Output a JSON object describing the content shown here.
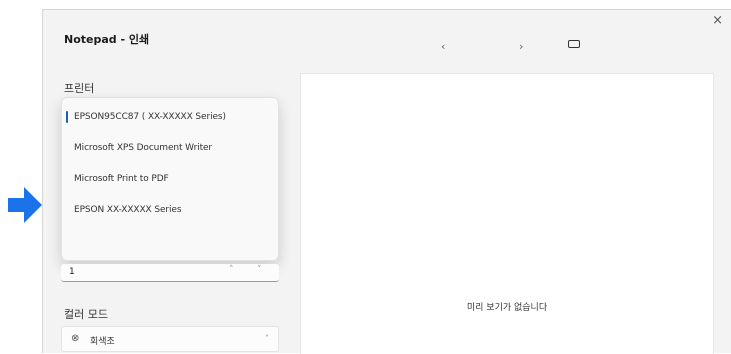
{
  "dialog": {
    "title": "Notepad - 인쇄",
    "close_label": "×",
    "nav_prev": "‹",
    "nav_next": "›"
  },
  "printer": {
    "section_label": "프린터",
    "options": [
      "EPSON95CC87 ( XX-XXXXX Series)",
      "Microsoft XPS Document Writer",
      "Microsoft Print to PDF",
      "EPSON XX-XXXXX Series"
    ]
  },
  "copies": {
    "value": "1",
    "up": "˄",
    "down": "˅"
  },
  "color_mode": {
    "section_label": "컬러 모드",
    "value": "회색조",
    "chevron": "˅"
  },
  "preview": {
    "empty_text": "미리 보기가 없습니다"
  },
  "colors": {
    "accent": "#1a5fb4",
    "arrow": "#1a73e8"
  }
}
